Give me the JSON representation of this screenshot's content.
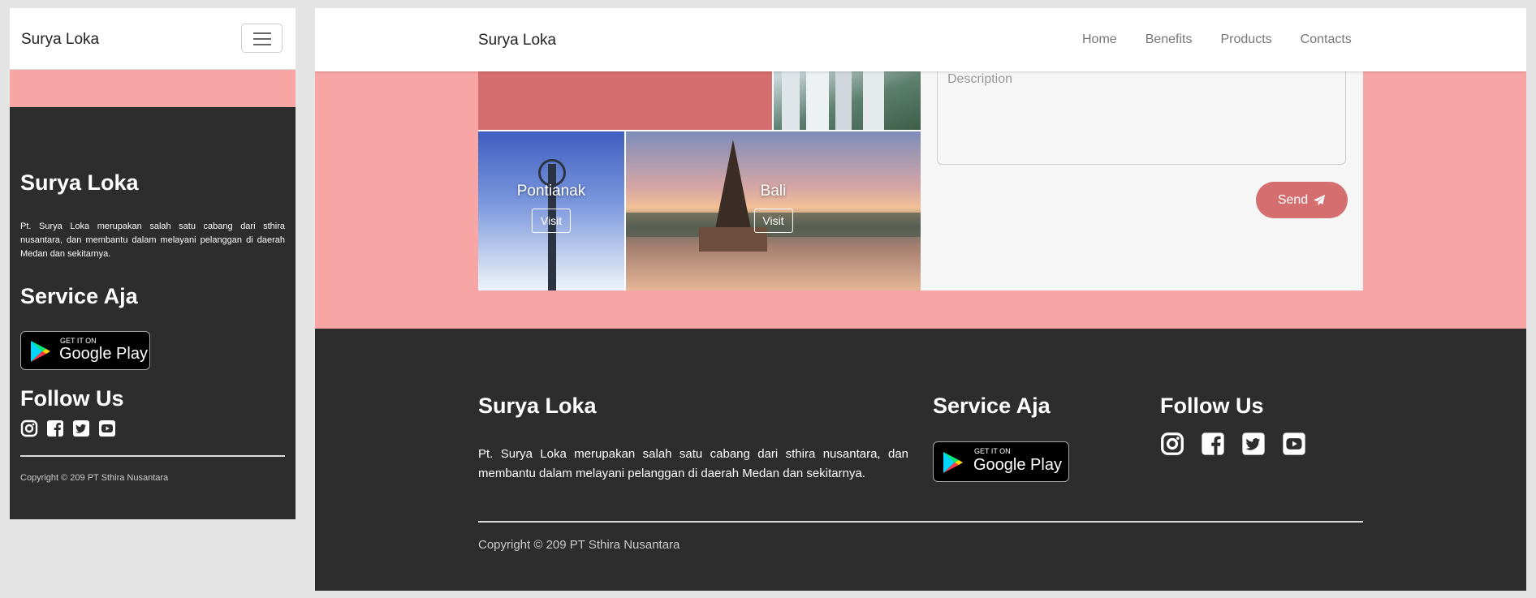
{
  "mobile": {
    "brand": "Surya Loka",
    "footer": {
      "title": "Surya Loka",
      "description": "Pt. Surya Loka merupakan salah satu cabang dari sthira nusantara, dan membantu dalam melayani pelanggan di daerah Medan dan sekitarnya.",
      "service_title": "Service Aja",
      "google_play_small": "GET IT ON",
      "google_play_big": "Google Play",
      "follow_title": "Follow Us",
      "copyright": "Copyright © 209 PT Sthira Nusantara"
    }
  },
  "desktop": {
    "brand": "Surya Loka",
    "nav": {
      "home": "Home",
      "benefits": "Benefits",
      "products": "Products",
      "contacts": "Contacts"
    },
    "gallery": {
      "pontianak": {
        "label": "Pontianak",
        "button": "Visit"
      },
      "bali": {
        "label": "Bali",
        "button": "Visit"
      }
    },
    "form": {
      "description_placeholder": "Description",
      "send_label": "Send"
    },
    "footer": {
      "title": "Surya Loka",
      "description": "Pt. Surya Loka merupakan salah satu cabang dari sthira nusantara, dan membantu dalam melayani pelanggan di daerah Medan dan sekitarnya.",
      "service_title": "Service Aja",
      "google_play_small": "GET IT ON",
      "google_play_big": "Google Play",
      "follow_title": "Follow Us",
      "copyright": "Copyright © 209 PT Sthira Nusantara"
    }
  },
  "icons": [
    "instagram-icon",
    "facebook-icon",
    "twitter-icon",
    "youtube-icon",
    "paper-plane-icon",
    "google-play-logo",
    "hamburger-icon"
  ],
  "colors": {
    "pink": "#f8a5a6",
    "accent": "#d46e6f",
    "footer_bg": "#2d2d2d"
  }
}
